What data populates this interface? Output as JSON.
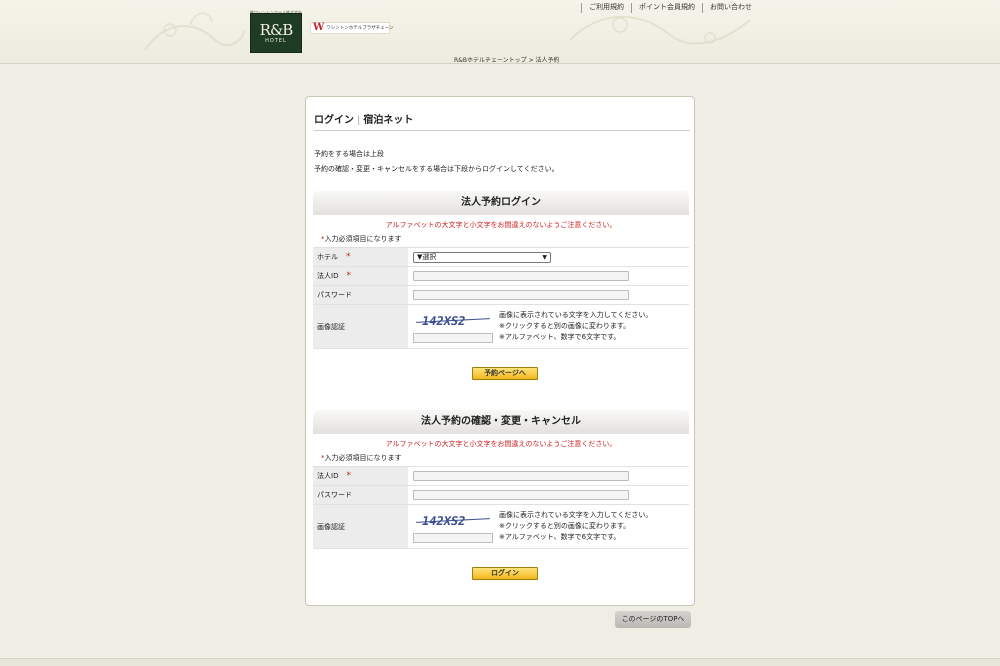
{
  "header": {
    "logo_tag": "株ワシントンホテル株式会社",
    "logo_main": "R&B",
    "logo_sub": "HOTEL",
    "wh_mark": "W",
    "wh_text": "ワシントンホテルプラザチェーン",
    "links": [
      "ご利用規約",
      "ポイント会員規約",
      "お問い合わせ"
    ],
    "breadcrumb": "R&Bホテルチェーントップ > 法人予約"
  },
  "panel": {
    "title_a": "ログイン",
    "title_sep": "|",
    "title_b": "宿泊ネット",
    "intro_1": "予約をする場合は上段",
    "intro_2": "予約の確認・変更・キャンセルをする場合は下段からログインしてください。"
  },
  "login": {
    "heading": "法人予約ログイン",
    "warning": "アルファベットの大文字と小文字をお間違えのないようご注意ください。",
    "req_star": "*",
    "req_note": "入力必須項目になります",
    "hotel_label": "ホテル",
    "hotel_value": "▼選択",
    "id_label": "法人ID",
    "password_label": "パスワード",
    "captcha_label": "画像認証",
    "captcha_code": "142XS2",
    "captcha_text_1": "画像に表示されている文字を入力してください。",
    "captcha_text_2": "※クリックすると別の画像に変わります。",
    "captcha_text_3": "※アルファベット、数字で6文字です。",
    "submit": "予約ページへ"
  },
  "manage": {
    "heading": "法人予約の確認・変更・キャンセル",
    "warning": "アルファベットの大文字と小文字をお間違えのないようご注意ください。",
    "req_star": "*",
    "req_note": "入力必須項目になります",
    "id_label": "法人ID",
    "password_label": "パスワード",
    "captcha_label": "画像認証",
    "captcha_code": "142XS2",
    "captcha_text_1": "画像に表示されている文字を入力してください。",
    "captcha_text_2": "※クリックすると別の画像に変わります。",
    "captcha_text_3": "※アルファベット、数字で6文字です。",
    "submit": "ログイン"
  },
  "footer": {
    "page_top": "このページのTOPへ"
  },
  "colors": {
    "accent_red": "#cc1f1f",
    "button_gold": "#f1b71d",
    "logo_green": "#1f3b24"
  }
}
